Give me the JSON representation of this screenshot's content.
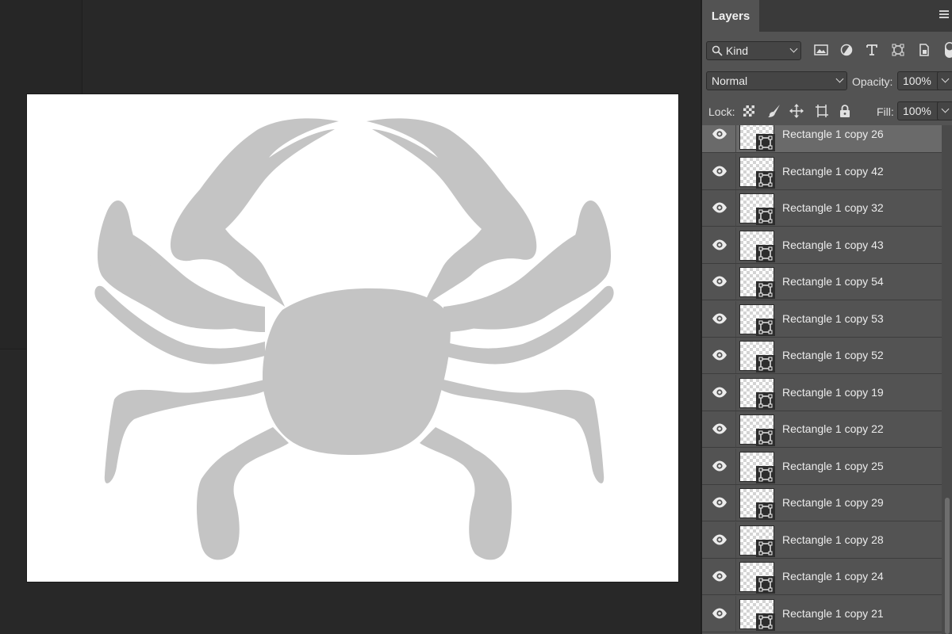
{
  "workspace": {
    "canvas_bg": "#ffffff",
    "silhouette_color": "#c4c4c4"
  },
  "panel": {
    "tab": "Layers",
    "filter": {
      "selected": "Kind",
      "icons": [
        "image-filter-icon",
        "adjustment-filter-icon",
        "type-filter-icon",
        "shape-filter-icon",
        "smart-object-filter-icon",
        "filter-toggle-icon"
      ]
    },
    "blend_mode": "Normal",
    "opacity_label": "Opacity:",
    "opacity": "100%",
    "lock_label": "Lock:",
    "lock_icons": [
      "lock-transparent-pixels-icon",
      "lock-image-pixels-icon",
      "lock-position-icon",
      "lock-artboard-icon",
      "lock-all-icon"
    ],
    "fill_label": "Fill:",
    "fill": "100%",
    "layers": [
      {
        "name": "Rectangle 1 copy 26",
        "selected": true
      },
      {
        "name": "Rectangle 1 copy 42",
        "selected": false
      },
      {
        "name": "Rectangle 1 copy 32",
        "selected": false
      },
      {
        "name": "Rectangle 1 copy 43",
        "selected": false
      },
      {
        "name": "Rectangle 1 copy 54",
        "selected": false
      },
      {
        "name": "Rectangle 1 copy 53",
        "selected": false
      },
      {
        "name": "Rectangle 1 copy 52",
        "selected": false
      },
      {
        "name": "Rectangle 1 copy 19",
        "selected": false
      },
      {
        "name": "Rectangle 1 copy 22",
        "selected": false
      },
      {
        "name": "Rectangle 1 copy 25",
        "selected": false
      },
      {
        "name": "Rectangle 1 copy 29",
        "selected": false
      },
      {
        "name": "Rectangle 1 copy 28",
        "selected": false
      },
      {
        "name": "Rectangle 1 copy 24",
        "selected": false
      },
      {
        "name": "Rectangle 1 copy 21",
        "selected": false
      }
    ]
  }
}
